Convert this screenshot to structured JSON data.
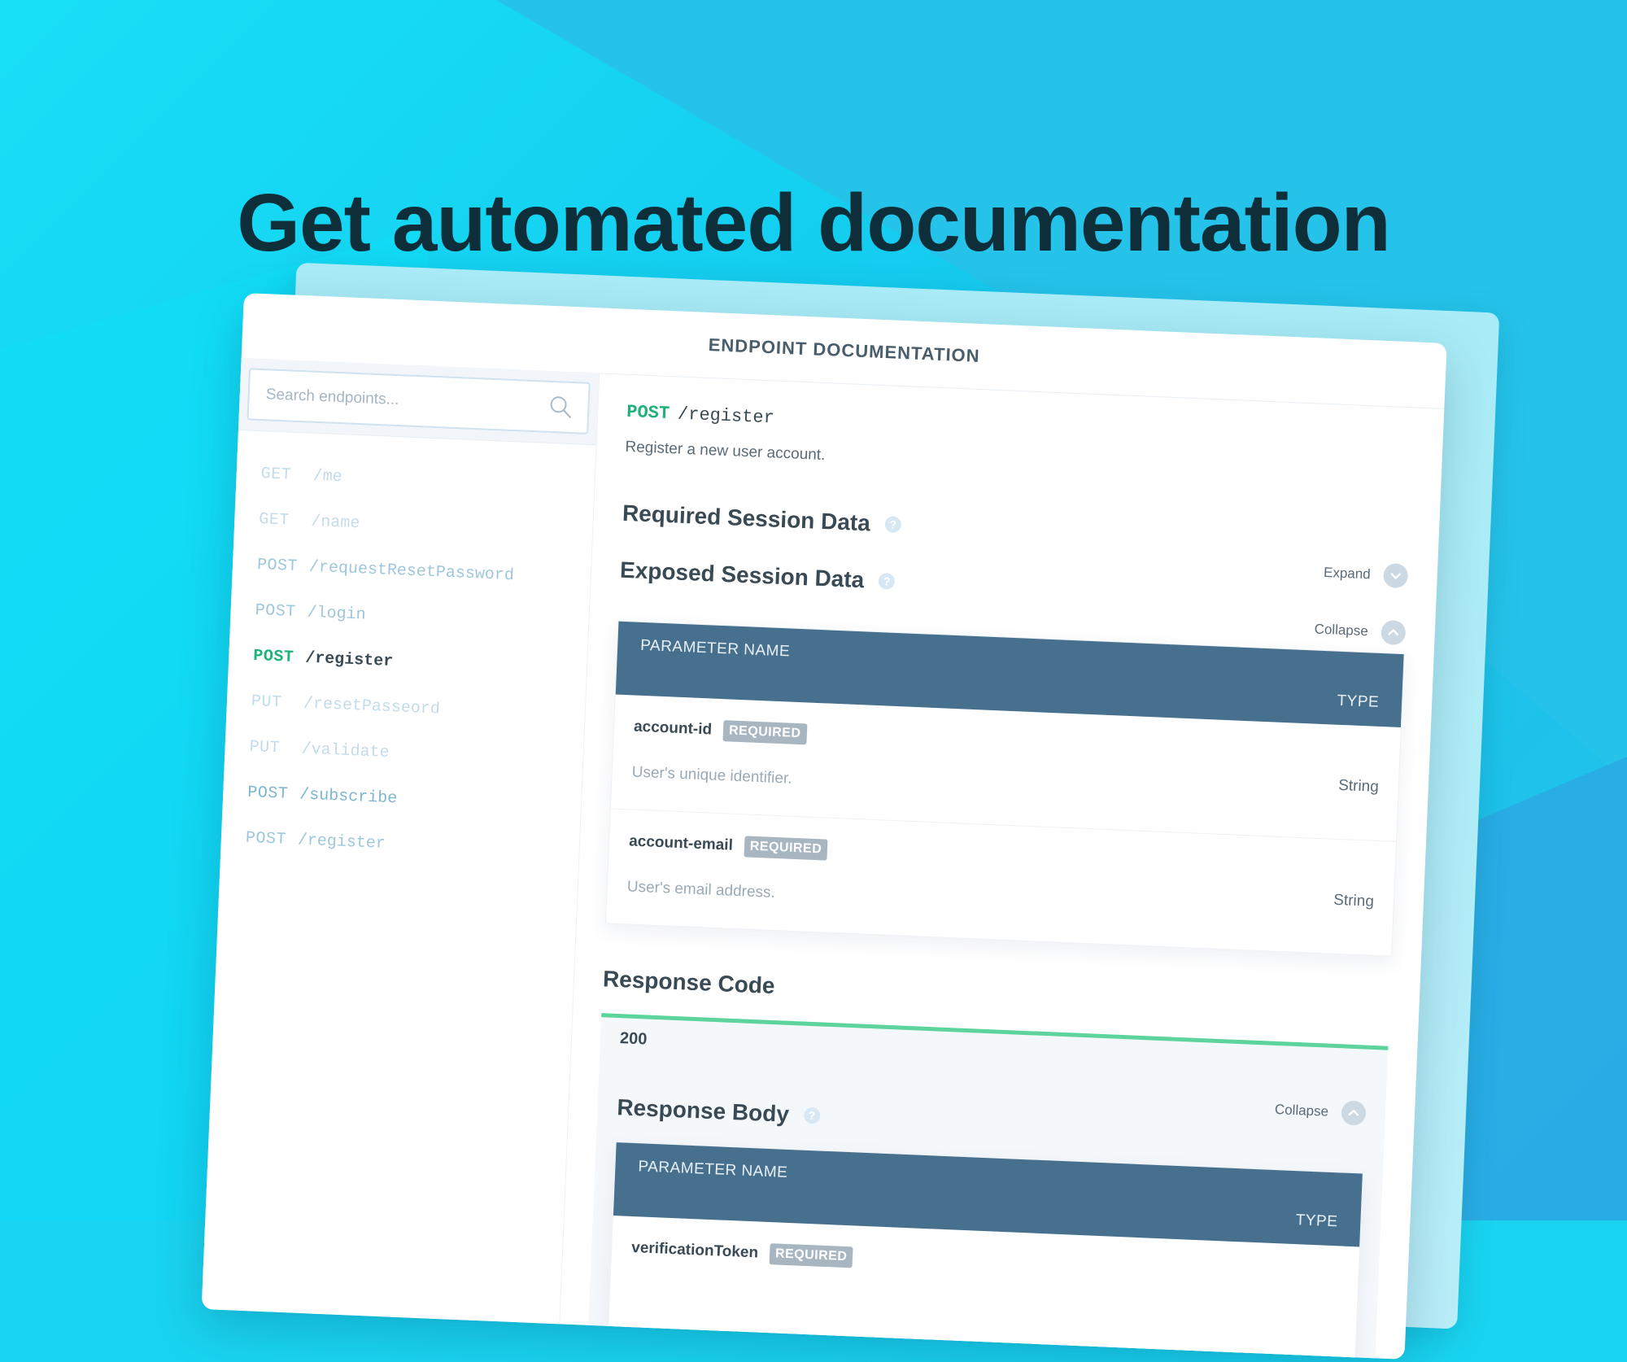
{
  "headline": "Get automated documentation",
  "panel": {
    "title": "ENDPOINT DOCUMENTATION"
  },
  "search": {
    "placeholder": "Search endpoints..."
  },
  "endpoints": [
    {
      "method": "GET",
      "path": "/me"
    },
    {
      "method": "GET",
      "path": "/name"
    },
    {
      "method": "POST",
      "path": "/requestResetPassword"
    },
    {
      "method": "POST",
      "path": "/login"
    },
    {
      "method": "POST",
      "path": "/register",
      "active": true
    },
    {
      "method": "PUT",
      "path": "/resetPasseord"
    },
    {
      "method": "PUT",
      "path": "/validate"
    },
    {
      "method": "POST",
      "path": "/subscribe"
    },
    {
      "method": "POST",
      "path": "/register"
    }
  ],
  "detail": {
    "method": "POST",
    "path": "/register",
    "description": "Register a new user account.",
    "required_session": {
      "title": "Required Session Data",
      "toggle_label": "Expand"
    },
    "exposed_session": {
      "title": "Exposed Session Data",
      "toggle_label": "Collapse",
      "col_name": "PARAMETER NAME",
      "col_type": "TYPE",
      "rows": [
        {
          "name": "account-id",
          "badge": "REQUIRED",
          "description": "User's unique identifier.",
          "type": "String"
        },
        {
          "name": "account-email",
          "badge": "REQUIRED",
          "description": "User's email address.",
          "type": "String"
        }
      ]
    },
    "response": {
      "title": "Response Code",
      "code": "200",
      "body_title": "Response Body",
      "toggle_label": "Collapse",
      "col_name": "PARAMETER NAME",
      "col_type": "TYPE",
      "rows": [
        {
          "name": "verificationToken",
          "badge": "REQUIRED"
        }
      ]
    }
  },
  "colors": {
    "accent_green": "#1fb37a",
    "table_header": "#46708e",
    "background_cyan": "#19d4f0",
    "response_border": "#5dd49b"
  },
  "icons": [
    "search-icon",
    "help-icon",
    "chevron-down-icon",
    "chevron-up-icon"
  ]
}
